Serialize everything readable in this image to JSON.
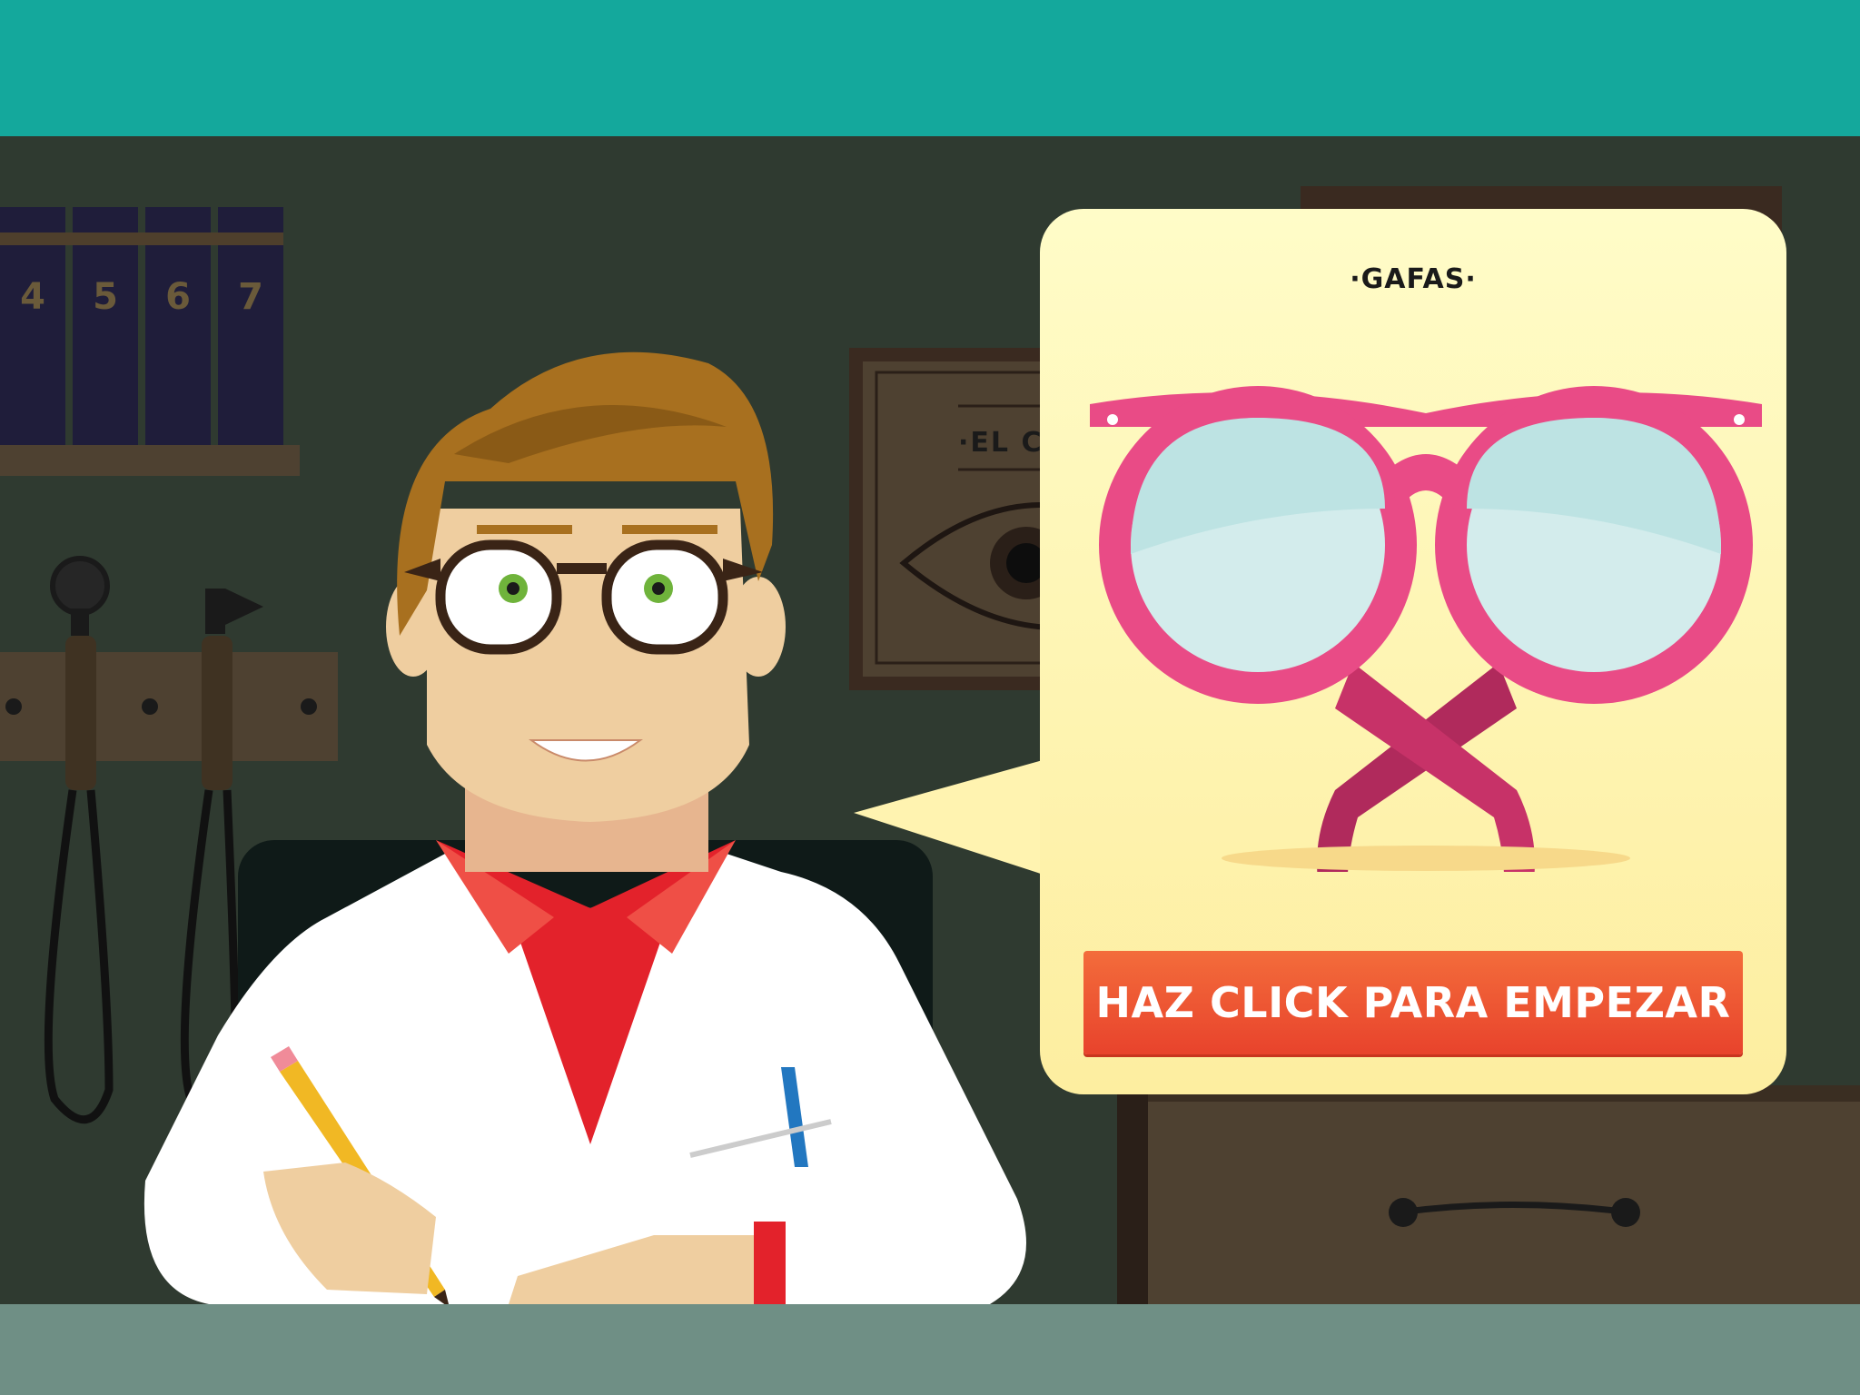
{
  "bookshelf": {
    "volumes": [
      "4",
      "5",
      "6",
      "7"
    ]
  },
  "wall_frame": {
    "text": "·EL C"
  },
  "bubble": {
    "title": "·GAFAS·",
    "button_label": "HAZ CLICK PARA EMPEZAR"
  },
  "colors": {
    "top_bar": "#14a89c",
    "wall": "#2f3a30",
    "bubble": "#fff8c0",
    "glasses_frame": "#e94b86",
    "button": "#ef5a32",
    "desk": "#6f8f85"
  },
  "icons": [
    "glasses-icon",
    "pencil-icon",
    "pen-icon",
    "eye-chart-icon",
    "otoscope-icon"
  ]
}
